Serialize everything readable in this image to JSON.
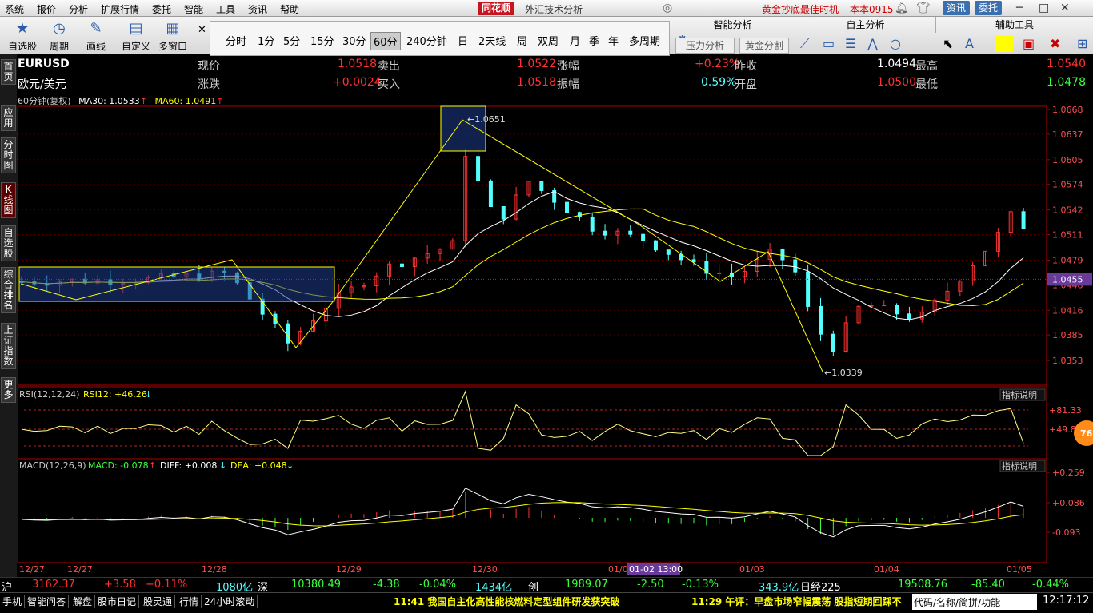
{
  "menu": {
    "items": [
      "系统",
      "报价",
      "分析",
      "扩展行情",
      "委托",
      "智能",
      "工具",
      "资讯",
      "帮助"
    ],
    "brand": "同花顺",
    "brand_sub": "- 外汇技术分析",
    "gold_ad": "黄金抄底最佳时机",
    "version": "本本0915",
    "btn_news": "资讯",
    "btn_trade": "委托"
  },
  "toolbar": {
    "buttons": [
      "自选股",
      "周期",
      "画线",
      "自定义",
      "多窗口"
    ],
    "close": "✕"
  },
  "periods": {
    "items": [
      "分时",
      "1分",
      "5分",
      "15分",
      "30分",
      "60分",
      "240分钟",
      "日",
      "2天线",
      "周",
      "双周",
      "月",
      "季",
      "年",
      "多周期"
    ],
    "selected": "60分"
  },
  "smart": {
    "tabs": [
      "智能分析",
      "自主分析",
      "辅助工具"
    ],
    "buttons": [
      "压力分析",
      "黄金分割"
    ]
  },
  "sidetabs": [
    "首页",
    "应用",
    "分时图",
    "K线图",
    "自选股",
    "综合排名",
    "上证指数",
    "更多"
  ],
  "quote": {
    "symbol": "EURUSD",
    "name": "欧元/美元",
    "row1": [
      {
        "label": "现价",
        "value": "1.0518"
      },
      {
        "label": "卖出",
        "value": "1.0522"
      },
      {
        "label": "涨幅",
        "value": "+0.23%"
      },
      {
        "label": "昨收",
        "value": "1.0494"
      },
      {
        "label": "最高",
        "value": "1.0540"
      }
    ],
    "row2": [
      {
        "label": "涨跌",
        "value": "+0.0024"
      },
      {
        "label": "买入",
        "value": "1.0518"
      },
      {
        "label": "振幅",
        "value": "0.59%"
      },
      {
        "label": "开盘",
        "value": "1.0500"
      },
      {
        "label": "最低",
        "value": "1.0478"
      }
    ]
  },
  "indicators": {
    "ma_title": "60分钟(复权)",
    "ma30": "MA30: 1.0533",
    "ma60": "MA60: 1.0491",
    "rsi": "RSI(12,12,24)",
    "rsi_val": "RSI12: +46.26",
    "macd": "MACD(12,26,9)",
    "macd_val": "MACD: -0.078",
    "diff": "DIFF: +0.008",
    "dea": "DEA: +0.048",
    "explain": "指标说明"
  },
  "chart_data": {
    "type": "candlestick",
    "symbol": "EURUSD",
    "period": "60分",
    "y_ticks": [
      "1.0668",
      "1.0637",
      "1.0605",
      "1.0574",
      "1.0542",
      "1.0511",
      "1.0479",
      "1.0448",
      "1.0416",
      "1.0385",
      "1.0353"
    ],
    "ylim": [
      1.0322,
      1.0672
    ],
    "current_price": "1.0455",
    "annotations": [
      "1.0651",
      "1.0339"
    ],
    "x_ticks": [
      "12/27",
      "12/27",
      "12/28",
      "12/29",
      "12/30",
      "01/02",
      "01/03",
      "01/04",
      "01/05"
    ],
    "cursor_label": "01-02 13:00",
    "rsi_ticks": [
      "81.33",
      "49.84"
    ],
    "macd_ticks": [
      "0.259",
      "0.086",
      "-0.093"
    ],
    "badge": "76"
  },
  "status": {
    "sh": "沪",
    "sh_val": "3162.37",
    "sh_chg": "+3.58",
    "sh_pct": "+0.11%",
    "sh_vol": "1080亿",
    "sz": "深",
    "sz_val": "10380.49",
    "sz_chg": "-4.38",
    "sz_pct": "-0.04%",
    "sz_vol": "1434亿",
    "cy": "创",
    "cy_val": "1989.07",
    "cy_chg": "-2.50",
    "cy_pct": "-0.13%",
    "cy_vol": "343.9亿",
    "nk": "日经225",
    "nk_val": "19508.76",
    "nk_chg": "-85.40",
    "nk_pct": "-0.44%"
  },
  "bottom": {
    "tabs": [
      "手机",
      "智能问答",
      "解盘",
      "股市日记",
      "股灵通",
      "行情",
      "24小时滚动"
    ],
    "news1": "11:41 我国自主化高性能核燃料定型组件研发获突破",
    "news2": "11:29 午评：早盘市场窄幅震荡 股指短期回踩不",
    "codebox": "代码/名称/简拼/功能",
    "clock": "12:17:12"
  },
  "colors": {
    "up": "#ff3232",
    "down": "#54ffff",
    "ma30": "#ffffff",
    "ma60": "#ffff00",
    "label": "#ff5050"
  }
}
